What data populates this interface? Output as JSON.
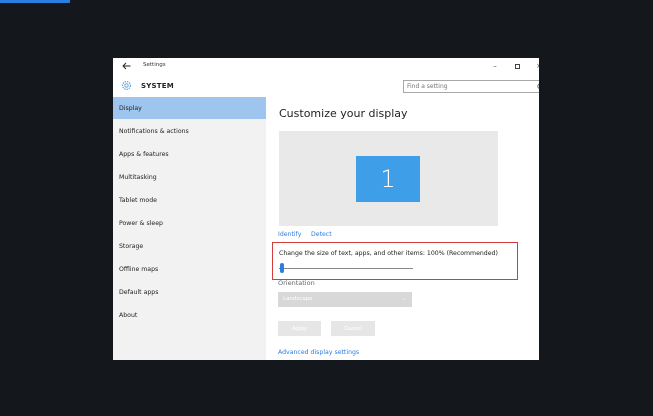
{
  "window": {
    "title": "Settings",
    "controls": {
      "minimize": "–",
      "close": "×"
    }
  },
  "header": {
    "section_title": "SYSTEM",
    "search": {
      "placeholder": "Find a setting",
      "value": ""
    }
  },
  "sidebar": {
    "selected_index": 0,
    "items": [
      {
        "label": "Display"
      },
      {
        "label": "Notifications & actions"
      },
      {
        "label": "Apps & features"
      },
      {
        "label": "Multitasking"
      },
      {
        "label": "Tablet mode"
      },
      {
        "label": "Power & sleep"
      },
      {
        "label": "Storage"
      },
      {
        "label": "Offline maps"
      },
      {
        "label": "Default apps"
      },
      {
        "label": "About"
      }
    ]
  },
  "main": {
    "title": "Customize your display",
    "monitor_number": "1",
    "links": {
      "identify": "Identify",
      "detect": "Detect",
      "advanced": "Advanced display settings"
    },
    "scaling": {
      "label": "Change the size of text, apps, and other items: 100% (Recommended)",
      "slider_fraction": 0.0
    },
    "orientation": {
      "label": "Orientation",
      "selected": "Landscape"
    },
    "buttons": {
      "apply": "Apply",
      "cancel": "Cancel"
    }
  },
  "colors": {
    "accent": "#2b7de0",
    "selection": "#9ec5ee",
    "monitor": "#3f9ee8",
    "highlight_border": "#d43b3b",
    "desktop": "#14171c"
  },
  "icons": [
    "back-arrow-icon",
    "gear-icon",
    "search-icon",
    "chevron-down-icon"
  ]
}
